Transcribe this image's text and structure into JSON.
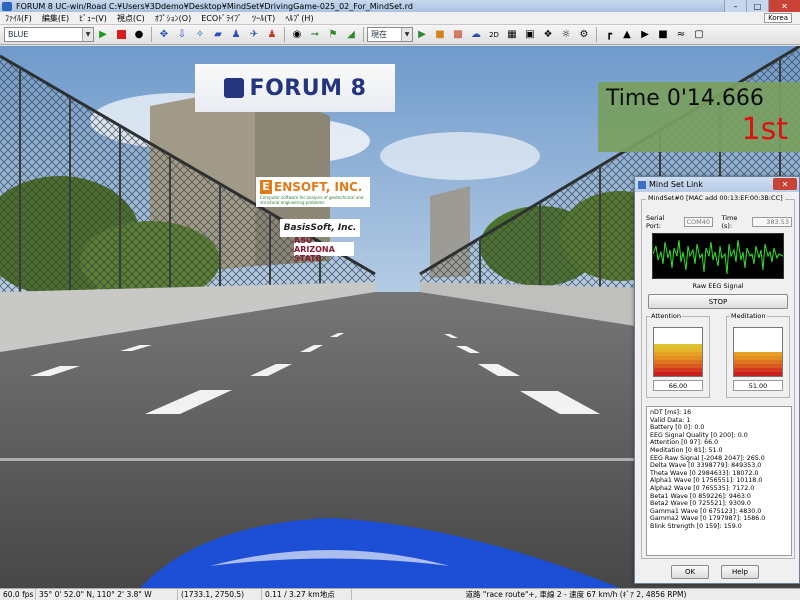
{
  "window": {
    "title": "FORUM 8    UC-win/Road    C:¥Users¥3Ddemo¥Desktop¥MindSet¥DrivingGame-025_02_For_MindSet.rd"
  },
  "menu": [
    "ﾌｧｲﾙ(F)",
    "編集(E)",
    "ﾋﾞｭｰ(V)",
    "視点(C)",
    "ｵﾌﾟｼｮﾝ(O)",
    "ECOﾄﾞﾗｲﾌﾞ",
    "ﾂｰﾙ(T)",
    "ﾍﾙﾌﾟ(H)"
  ],
  "ime_indicator": "Korea",
  "toolbar": {
    "combo_value": "BLUE",
    "view_combo_value": "現在"
  },
  "overlay": {
    "time_text": "Time  0'14.666",
    "rank_text": "1st"
  },
  "signs": {
    "forum8": "FORUM 8",
    "ensoft": "ENSOFT, INC.",
    "ensoft_tag": "Computer software for analysis of geotechnical and structural engineering problems",
    "basis": "BasisSoft, Inc.",
    "asu": "ASU ARIZONA STATE"
  },
  "dialog": {
    "title": "Mind Set Link",
    "group_label": "MindSet#0 [MAC add 00:13:EF:00:3B:CC]",
    "serial_label": "Serial Port:",
    "serial_value": "COM40",
    "time_label": "Time (s):",
    "time_value": "383.53",
    "eeg_label": "Raw EEG Signal",
    "stop_label": "STOP",
    "attention": {
      "label": "Attention",
      "value": "66.00",
      "level": 66
    },
    "meditation": {
      "label": "Meditation",
      "value": "51.00",
      "level": 51
    },
    "stats": [
      "nDT [ms]: 16",
      "Valid Data: 1",
      "Battery [0 0]: 0.0",
      "EEG Signal Quality [0 200]: 0.0",
      "Attention [0 97]: 66.0",
      "Meditation [0 81]: 51.0",
      "EEG Raw Signal [-2048 2047]: 265.0",
      "Delta Wave [0 3398779]: 849353.0",
      "Theta Wave [0 2984633]: 18072.0",
      "Alpha1 Wave [0 1756551]: 10118.0",
      "Alpha2 Wave [0 765535]: 7172.0",
      "Beta1 Wave [0 859226]: 9463.0",
      "Beta2 Wave [0 725521]: 9309.0",
      "Gamma1 Wave [0 675123]: 4830.0",
      "Gamma2 Wave [0 1797987]: 1586.0",
      "Blink Strength [0 159]: 159.0"
    ],
    "ok_label": "OK",
    "help_label": "Help"
  },
  "status": [
    "60.0 fps",
    "35° 0' 52.0\" N, 110° 2' 3.8\" W",
    "(1733.1, 2750.5)",
    "0.11 / 3.27 km地点",
    "道路 \"race route\"+, 車線 2 - 速度 67 km/h (ｷﾞｱ 2, 4856 RPM)"
  ],
  "colors": {
    "sky": "#7fa6d4",
    "road": "#5d5d5d",
    "timebox": "#7aa060",
    "rank": "#e01010",
    "car": "#1d4fd6"
  }
}
